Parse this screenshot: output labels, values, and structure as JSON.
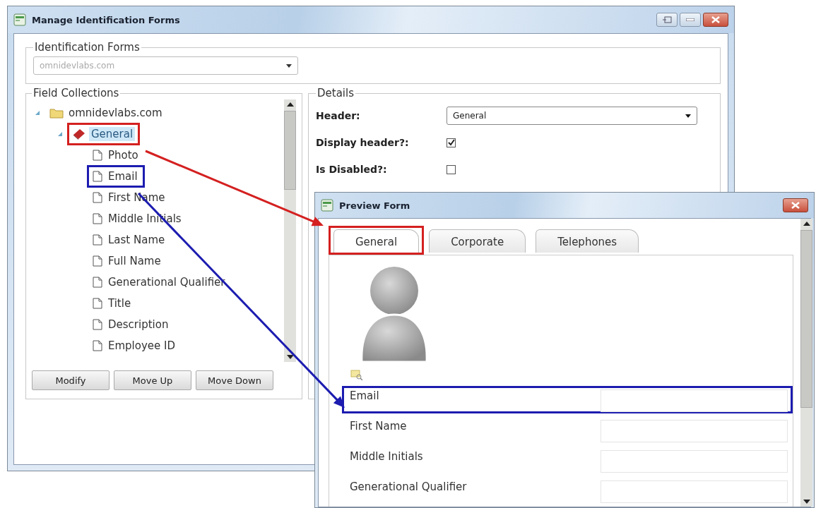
{
  "main_window": {
    "title": "Manage Identification Forms"
  },
  "identification_forms": {
    "legend": "Identification Forms",
    "value": "omnidevlabs.com",
    "disabled": true
  },
  "field_collections": {
    "legend": "Field Collections",
    "tree": [
      {
        "label": "omnidevlabs.com",
        "kind": "folder",
        "expanded": true,
        "selected": false,
        "children": [
          {
            "label": "General",
            "kind": "group",
            "expanded": true,
            "selected": true,
            "color": "#d42020",
            "children": [
              {
                "label": "Photo",
                "kind": "field",
                "selected": false
              },
              {
                "label": "Email",
                "kind": "field",
                "selected": false,
                "color": "#1c1cb0"
              },
              {
                "label": "First Name",
                "kind": "field",
                "selected": false
              },
              {
                "label": "Middle Initials",
                "kind": "field",
                "selected": false
              },
              {
                "label": "Last Name",
                "kind": "field",
                "selected": false
              },
              {
                "label": "Full Name",
                "kind": "field",
                "selected": false
              },
              {
                "label": "Generational Qualifier",
                "kind": "field",
                "selected": false
              },
              {
                "label": "Title",
                "kind": "field",
                "selected": false
              },
              {
                "label": "Description",
                "kind": "field",
                "selected": false
              },
              {
                "label": "Employee ID",
                "kind": "field",
                "selected": false
              }
            ]
          }
        ]
      }
    ],
    "buttons": [
      "Modify",
      "Move Up",
      "Move Down"
    ]
  },
  "details": {
    "legend": "Details",
    "fields": [
      {
        "label": "Header:",
        "kind": "dropdown",
        "value": "General"
      },
      {
        "label": "Display header?:",
        "kind": "checkbox",
        "checked": true
      },
      {
        "label": "Is Disabled?:",
        "kind": "checkbox",
        "checked": false
      }
    ]
  },
  "preview_window": {
    "title": "Preview Form",
    "tabs": [
      {
        "label": "General",
        "selected": true,
        "color": "#d42020"
      },
      {
        "label": "Corporate",
        "selected": false
      },
      {
        "label": "Telephones",
        "selected": false
      }
    ],
    "fields": [
      {
        "label": "Email",
        "color": "#1c1cb0"
      },
      {
        "label": "First Name"
      },
      {
        "label": "Middle Initials"
      },
      {
        "label": "Generational Qualifier"
      }
    ]
  },
  "arrows": [
    {
      "color": "#d42020"
    },
    {
      "color": "#1c1cb0"
    }
  ]
}
